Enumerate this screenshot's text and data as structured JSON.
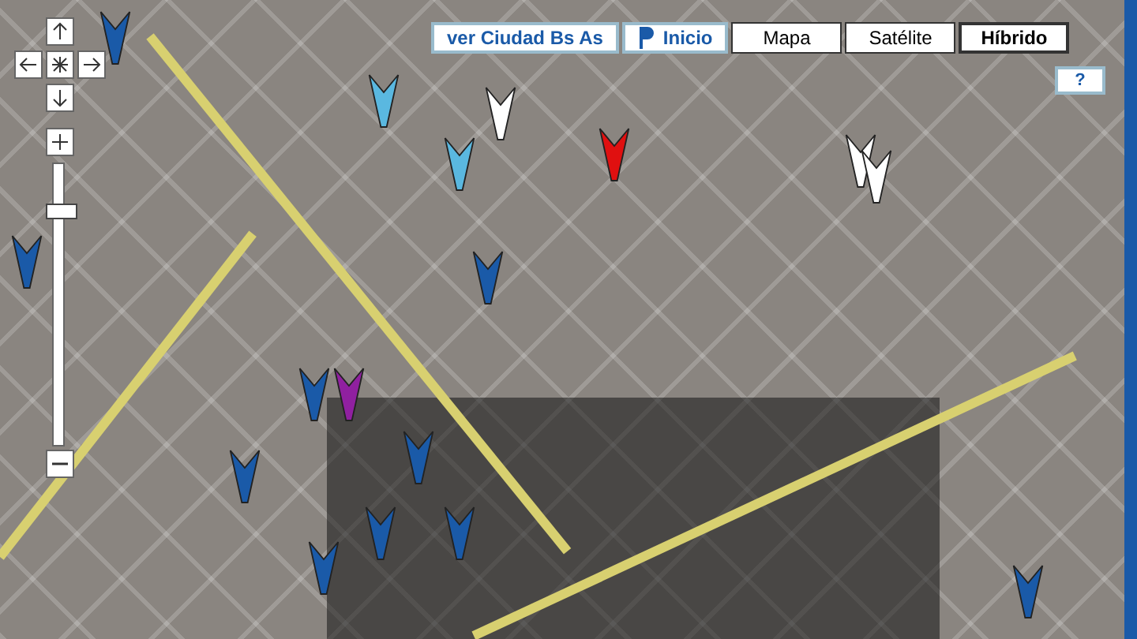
{
  "toolbar": {
    "city_link": "ver Ciudad Bs As",
    "home_button": {
      "label": "Inicio"
    },
    "map_types": [
      {
        "label": "Mapa",
        "selected": false
      },
      {
        "label": "Satélite",
        "selected": false
      },
      {
        "label": "Híbrido",
        "selected": true
      }
    ],
    "help_button": "?"
  },
  "markers": [
    {
      "color": "#1a5aa8"
    },
    {
      "color": "#5ab8e0"
    },
    {
      "color": "#ffffff"
    },
    {
      "color": "#e01010"
    },
    {
      "color": "#5ab8e0"
    },
    {
      "color": "#ffffff"
    },
    {
      "color": "#ffffff"
    },
    {
      "color": "#1a5aa8"
    },
    {
      "color": "#1a5aa8"
    },
    {
      "color": "#1a5aa8"
    },
    {
      "color": "#9020a0"
    },
    {
      "color": "#1a5aa8"
    },
    {
      "color": "#1a5aa8"
    },
    {
      "color": "#1a5aa8"
    },
    {
      "color": "#1a5aa8"
    },
    {
      "color": "#1a5aa8"
    },
    {
      "color": "#1a5aa8"
    }
  ]
}
